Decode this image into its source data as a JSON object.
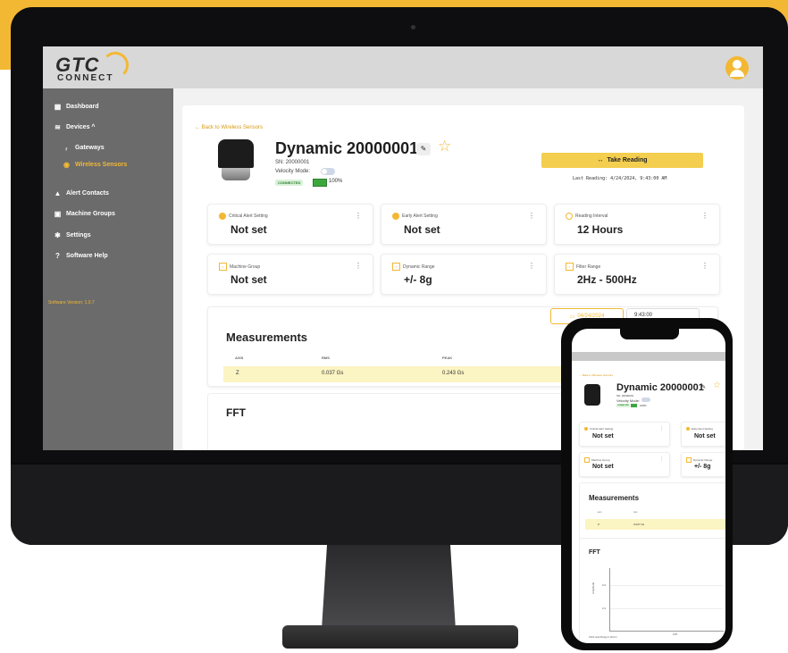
{
  "app": {
    "logo_main": "GTC",
    "logo_sub": "CONNECT"
  },
  "sidebar": {
    "items": [
      {
        "label": "Dashboard",
        "icon": "dashboard-icon"
      },
      {
        "label": "Devices ^",
        "icon": "wifi-icon"
      },
      {
        "label": "Gateways",
        "icon": "gateway-icon"
      },
      {
        "label": "Wireless Sensors",
        "icon": "wireless-icon",
        "active": true
      },
      {
        "label": "Alert Contacts",
        "icon": "bell-icon"
      },
      {
        "label": "Machine Groups",
        "icon": "machine-group-icon"
      },
      {
        "label": "Settings",
        "icon": "gear-icon"
      },
      {
        "label": "Software Help",
        "icon": "help-icon"
      }
    ],
    "version": "Software Version: 1.0.7"
  },
  "sensor": {
    "back_label": "← Back to Wireless Sensors",
    "title": "Dynamic 20000001",
    "sn": "SN: 20000001",
    "velocity_label": "Velocity Mode:",
    "status": "CONNECTED",
    "battery": "100%",
    "take_reading": "Take Reading",
    "last_reading": "Last Reading: 4/24/2024, 9:43:00 AM"
  },
  "cards": [
    {
      "label": "Critical Alert Setting",
      "value": "Not set",
      "icon": "alert-dot-icon"
    },
    {
      "label": "Early Alert Setting",
      "value": "Not set",
      "icon": "alert-dot-icon"
    },
    {
      "label": "Reading Interval",
      "value": "12 Hours",
      "icon": "clock-icon"
    },
    {
      "label": "Machine Group",
      "value": "Not set",
      "icon": "group-icon"
    },
    {
      "label": "Dynamic Range",
      "value": "+/- 8g",
      "icon": "range-icon"
    },
    {
      "label": "Filter Range",
      "value": "2Hz - 500Hz",
      "icon": "filter-icon"
    }
  ],
  "date_picker": {
    "date": "04/24/2024",
    "time": "9:43:00"
  },
  "measurements": {
    "title": "Measurements",
    "headers": [
      "AXIS",
      "RMS",
      "PEAK"
    ],
    "rows": [
      {
        "axis": "Z",
        "rms": "0.037 Gs",
        "peak": "0.243 Gs"
      }
    ]
  },
  "fft": {
    "title": "FFT"
  },
  "phone": {
    "back_label": "← Back to Wireless Sensors",
    "title": "Dynamic 20000001",
    "sn": "SN: 20000001",
    "velocity_label": "Velocity Mode:",
    "status": "CONNECTED",
    "battery": "100%",
    "cards": [
      {
        "label": "Critical Alert Setting",
        "value": "Not set"
      },
      {
        "label": "Early Alert Setting",
        "value": "Not set"
      },
      {
        "label": "Machine Group",
        "value": "Not set"
      },
      {
        "label": "Dynamic Range",
        "value": "+/- 8g"
      }
    ],
    "measurements_title": "Measurements",
    "headers": [
      "AXIS",
      "RMS"
    ],
    "row": {
      "axis": "Z",
      "rms": "0.037 Gs"
    },
    "fft_title": "FFT",
    "y_label": "Amplitude",
    "y_ticks": [
      "0.2",
      "0.1"
    ],
    "x_tick": "125",
    "zoom_hint": "Click and Drag to Zoom"
  },
  "colors": {
    "accent": "#f3b833",
    "highlight_row": "#fbf4c3",
    "sidebar": "#6b6b6b"
  }
}
